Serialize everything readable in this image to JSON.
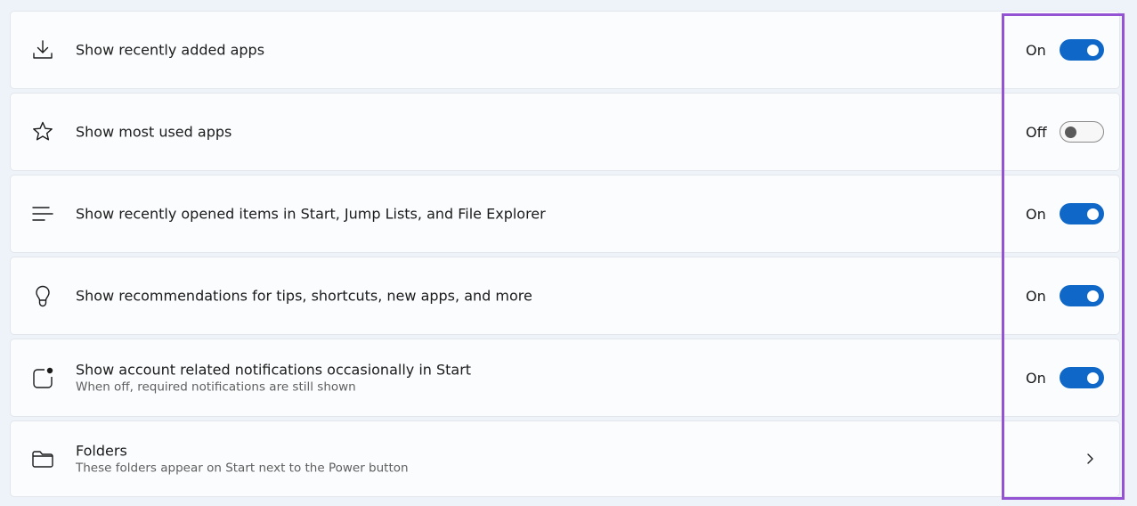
{
  "settings": {
    "rows": [
      {
        "icon": "download-icon",
        "title": "Show recently added apps",
        "state": "On",
        "enabled": true
      },
      {
        "icon": "star-icon",
        "title": "Show most used apps",
        "state": "Off",
        "enabled": false
      },
      {
        "icon": "list-icon",
        "title": "Show recently opened items in Start, Jump Lists, and File Explorer",
        "state": "On",
        "enabled": true
      },
      {
        "icon": "lightbulb-icon",
        "title": "Show recommendations for tips, shortcuts, new apps, and more",
        "state": "On",
        "enabled": true
      },
      {
        "icon": "notification-badge-icon",
        "title": "Show account related notifications occasionally in Start",
        "subtitle": "When off, required notifications are still shown",
        "state": "On",
        "enabled": true
      },
      {
        "icon": "folder-icon",
        "title": "Folders",
        "subtitle": "These folders appear on Start next to the Power button",
        "action": "chevron-right-icon"
      }
    ]
  },
  "colors": {
    "toggle_on": "#0f67c7",
    "highlight": "#9353d3",
    "background": "#eef2f9"
  }
}
